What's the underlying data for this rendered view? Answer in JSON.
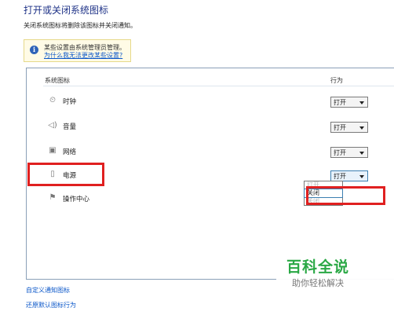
{
  "header": {
    "title": "打开或关闭系统图标",
    "description": "关闭系统图标将删除该图标并关闭通知。"
  },
  "notice": {
    "line1": "某些设置由系统管理员管理。",
    "link": "为什么我无法更改某些设置?"
  },
  "table": {
    "col_icon": "系统图标",
    "col_behavior": "行为",
    "rows": [
      {
        "label": "时钟",
        "value": "打开",
        "icon": "clock-icon"
      },
      {
        "label": "音量",
        "value": "打开",
        "icon": "volume-icon"
      },
      {
        "label": "网络",
        "value": "打开",
        "icon": "network-icon"
      },
      {
        "label": "电源",
        "value": "打开",
        "icon": "power-icon"
      },
      {
        "label": "操作中心",
        "value": "",
        "icon": "flag-icon"
      }
    ]
  },
  "dropdown": {
    "options": [
      "打开",
      "关闭",
      "关闭"
    ],
    "highlighted": "关闭"
  },
  "links": {
    "customize": "自定义通知图标",
    "restore": "还原默认图标行为"
  },
  "watermark": {
    "brand": "百科全说",
    "tagline": "助你轻松解决"
  },
  "colors": {
    "annotation_red": "#e02020",
    "title_blue": "#1e3287",
    "link_blue": "#0b57c9",
    "watermark_green": "#2aa845"
  }
}
